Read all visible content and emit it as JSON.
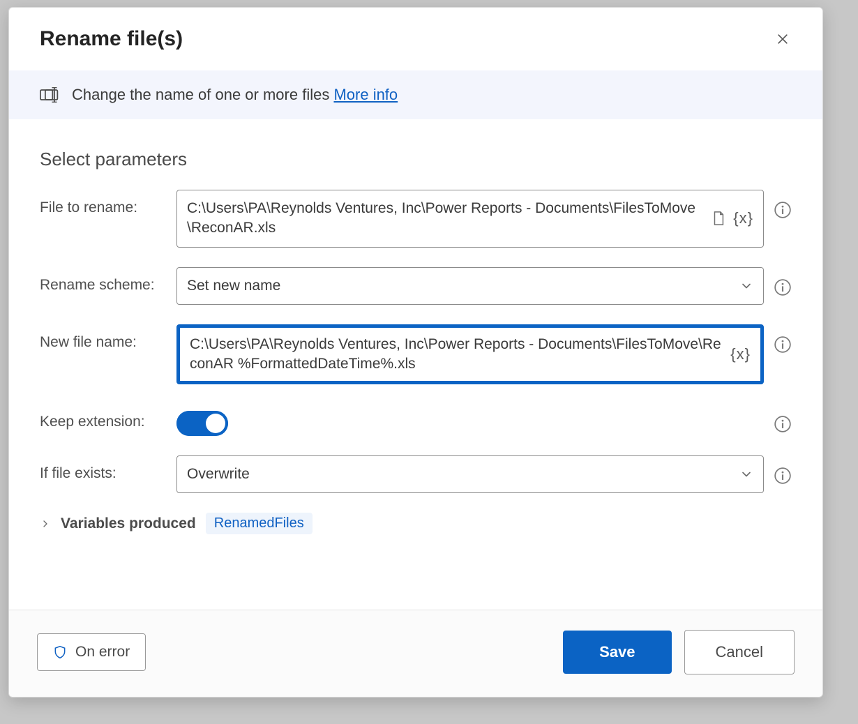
{
  "dialog": {
    "title": "Rename file(s)",
    "banner_text": "Change the name of one or more files ",
    "banner_link": "More info",
    "section_title": "Select parameters"
  },
  "fields": {
    "file_to_rename": {
      "label": "File to rename:",
      "value": "C:\\Users\\PA\\Reynolds Ventures, Inc\\Power Reports - Documents\\FilesToMove\\ReconAR.xls"
    },
    "rename_scheme": {
      "label": "Rename scheme:",
      "value": "Set new name"
    },
    "new_file_name": {
      "label": "New file name:",
      "value": "C:\\Users\\PA\\Reynolds Ventures, Inc\\Power Reports - Documents\\FilesToMove\\ReconAR %FormattedDateTime%.xls"
    },
    "keep_extension": {
      "label": "Keep extension:",
      "value": true
    },
    "if_file_exists": {
      "label": "If file exists:",
      "value": "Overwrite"
    }
  },
  "variables_produced": {
    "label": "Variables produced",
    "items": [
      "RenamedFiles"
    ]
  },
  "footer": {
    "on_error": "On error",
    "save": "Save",
    "cancel": "Cancel"
  },
  "glyphs": {
    "xvar": "{x}"
  }
}
